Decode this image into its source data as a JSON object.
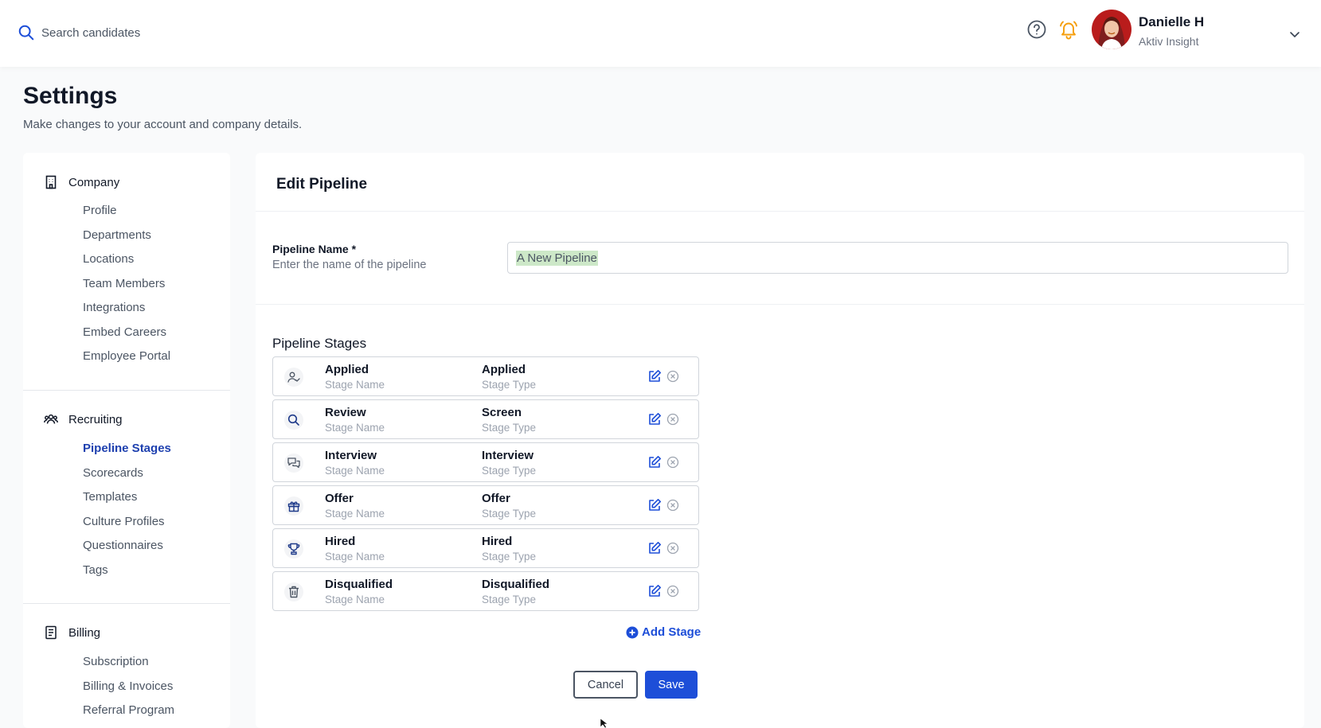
{
  "topbar": {
    "search_placeholder": "Search candidates",
    "user_name": "Danielle H",
    "user_company": "Aktiv Insight",
    "bell_color": "#f59e0b"
  },
  "header": {
    "title": "Settings",
    "subtitle": "Make changes to your account and company details."
  },
  "sidebar": {
    "company": {
      "label": "Company",
      "items": [
        "Profile",
        "Departments",
        "Locations",
        "Team Members",
        "Integrations",
        "Embed Careers",
        "Employee Portal"
      ]
    },
    "recruiting": {
      "label": "Recruiting",
      "items": [
        "Pipeline Stages",
        "Scorecards",
        "Templates",
        "Culture Profiles",
        "Questionnaires",
        "Tags"
      ],
      "active": "Pipeline Stages"
    },
    "billing": {
      "label": "Billing",
      "items": [
        "Subscription",
        "Billing & Invoices",
        "Referral Program"
      ]
    }
  },
  "main": {
    "title": "Edit Pipeline",
    "field_label": "Pipeline Name *",
    "field_help": "Enter the name of the pipeline",
    "field_value": "A New Pipeline",
    "stages_title": "Pipeline Stages",
    "stage_name_caption": "Stage Name",
    "stage_type_caption": "Stage Type",
    "stages": [
      {
        "name": "Applied",
        "type": "Applied",
        "icon": "user-check-icon"
      },
      {
        "name": "Review",
        "type": "Screen",
        "icon": "search-icon"
      },
      {
        "name": "Interview",
        "type": "Interview",
        "icon": "chat-bubbles-icon"
      },
      {
        "name": "Offer",
        "type": "Offer",
        "icon": "gift-icon"
      },
      {
        "name": "Hired",
        "type": "Hired",
        "icon": "trophy-icon"
      },
      {
        "name": "Disqualified",
        "type": "Disqualified",
        "icon": "trash-icon"
      }
    ],
    "add_stage_label": "Add Stage",
    "cancel_label": "Cancel",
    "save_label": "Save",
    "accent_color": "#1d4ed8"
  }
}
